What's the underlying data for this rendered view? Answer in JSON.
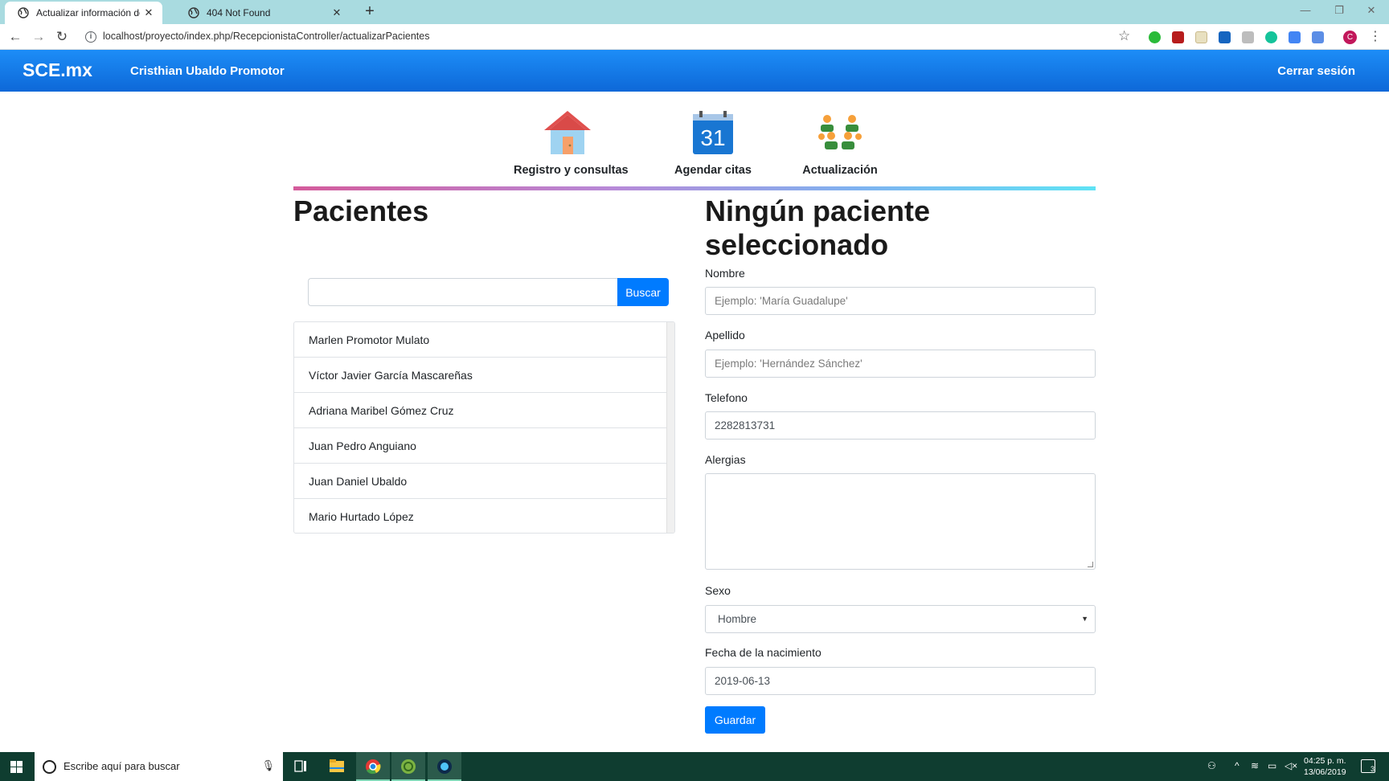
{
  "browser": {
    "tabs": [
      {
        "title": "Actualizar información de pacien",
        "active": true
      },
      {
        "title": "404 Not Found",
        "active": false
      }
    ],
    "url": "localhost/proyecto/index.php/RecepcionistaController/actualizarPacientes",
    "profile_initial": "C"
  },
  "header": {
    "brand": "SCE.mx",
    "user": "Cristhian Ubaldo Promotor",
    "logout": "Cerrar sesión",
    "color": "#1479e8"
  },
  "menu": [
    {
      "label": "Registro y consultas",
      "icon": "house-icon"
    },
    {
      "label": "Agendar citas",
      "icon": "calendar-icon",
      "calendar_number": "31"
    },
    {
      "label": "Actualización",
      "icon": "people-icon"
    }
  ],
  "patients": {
    "title": "Pacientes",
    "search_value": "",
    "search_button": "Buscar",
    "list": [
      "Marlen Promotor Mulato",
      "Víctor Javier García Mascareñas",
      "Adriana Maribel Gómez Cruz",
      "Juan Pedro Anguiano",
      "Juan Daniel Ubaldo",
      "Mario Hurtado López"
    ]
  },
  "form": {
    "title": "Ningún paciente seleccionado",
    "nombre_label": "Nombre",
    "nombre_placeholder": "Ejemplo: 'María Guadalupe'",
    "apellido_label": "Apellido",
    "apellido_placeholder": "Ejemplo: 'Hernández Sánchez'",
    "telefono_label": "Telefono",
    "telefono_value": "2282813731",
    "alergias_label": "Alergias",
    "alergias_value": "",
    "sexo_label": "Sexo",
    "sexo_value": "Hombre",
    "fecha_label": "Fecha de la nacimiento",
    "fecha_value": "2019-06-13",
    "save_button": "Guardar",
    "accent": "#007bff"
  },
  "taskbar": {
    "search_placeholder": "Escribe aquí para buscar",
    "time": "04:25 p. m.",
    "date": "13/06/2019",
    "notification_count": "3"
  }
}
